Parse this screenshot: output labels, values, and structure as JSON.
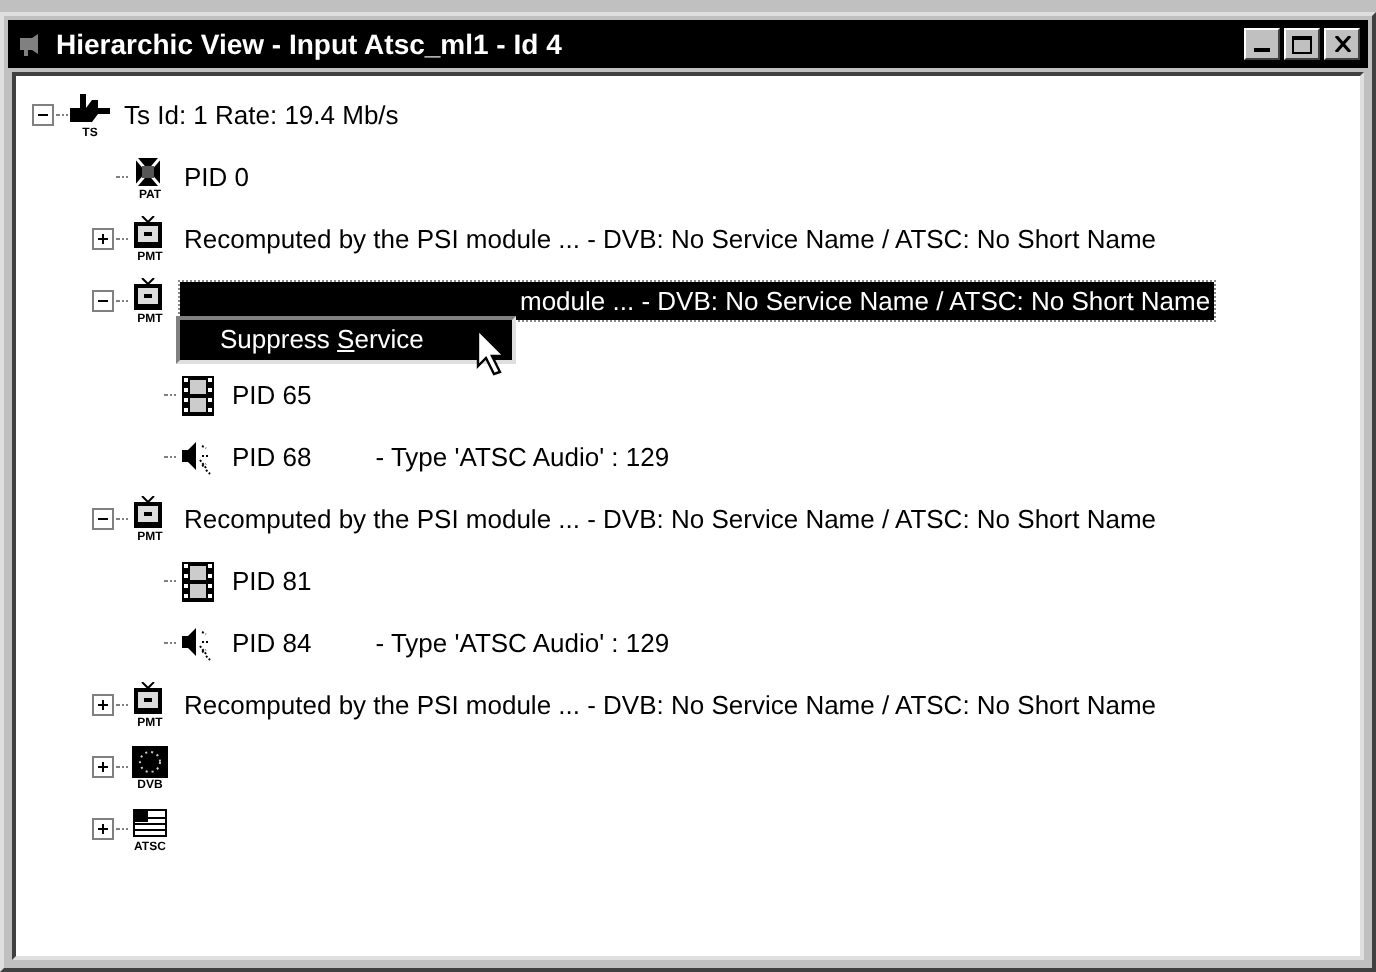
{
  "window": {
    "title": "Hierarchic View - Input Atsc_ml1 - Id 4"
  },
  "tree": {
    "kind": "ts",
    "caption": "TS",
    "label": "Ts Id: 1 Rate: 19.4 Mb/s",
    "expanded": true,
    "selected": false,
    "children": [
      {
        "kind": "pat",
        "caption": "PAT",
        "label": "PID 0",
        "selected": false
      },
      {
        "kind": "pmt",
        "caption": "PMT",
        "label": "Recomputed by the PSI module ... - DVB: No Service Name / ATSC: No Short Name",
        "expanded": false,
        "selected": false
      },
      {
        "kind": "pmt",
        "caption": "PMT",
        "label": "module ... - DVB: No Service Name / ATSC: No Short Name",
        "expanded": true,
        "selected": true,
        "children": [
          {
            "kind": "video",
            "label": "PID 65",
            "selected": false
          },
          {
            "kind": "audio",
            "label": "PID 68",
            "detail": "- Type 'ATSC Audio' : 129",
            "selected": false
          }
        ]
      },
      {
        "kind": "pmt",
        "caption": "PMT",
        "label": "Recomputed by the PSI module ... - DVB: No Service Name / ATSC: No Short Name",
        "expanded": true,
        "selected": false,
        "children": [
          {
            "kind": "video",
            "label": "PID 81",
            "selected": false
          },
          {
            "kind": "audio",
            "label": "PID 84",
            "detail": "- Type 'ATSC Audio' : 129",
            "selected": false
          }
        ]
      },
      {
        "kind": "pmt",
        "caption": "PMT",
        "label": "Recomputed by the PSI module ... - DVB: No Service Name / ATSC: No Short Name",
        "expanded": false,
        "selected": false
      },
      {
        "kind": "dvb",
        "caption": "DVB",
        "expanded": false,
        "selected": false
      },
      {
        "kind": "atsc",
        "caption": "ATSC",
        "expanded": false,
        "selected": false
      }
    ]
  },
  "context_menu": {
    "before": "Suppress ",
    "mnemonic": "S",
    "after": "ervice"
  }
}
